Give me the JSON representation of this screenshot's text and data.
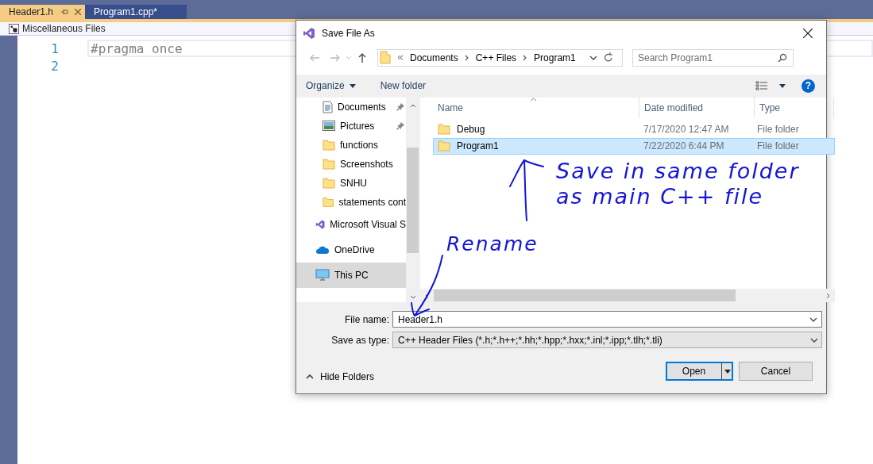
{
  "editor": {
    "tabs": [
      {
        "label": "Header1.h",
        "selected": true
      },
      {
        "label": "Program1.cpp*",
        "selected": false
      }
    ],
    "breadcrumb": "Miscellaneous Files",
    "lines": [
      {
        "number": "1",
        "code": "#pragma once",
        "current": true
      },
      {
        "number": "2",
        "current": false
      }
    ]
  },
  "dialog": {
    "title": "Save File As",
    "path": [
      "Documents",
      "C++ Files",
      "Program1"
    ],
    "search": {
      "placeholder": "Search Program1"
    },
    "toolbar": {
      "organize": "Organize",
      "new_folder": "New folder",
      "help": "?"
    },
    "sidebar": [
      {
        "label": "Documents",
        "kind": "document",
        "pinned": true,
        "selected": false
      },
      {
        "label": "Pictures",
        "kind": "pictures",
        "pinned": true,
        "selected": false
      },
      {
        "label": "functions",
        "kind": "folder",
        "pinned": false,
        "selected": false
      },
      {
        "label": "Screenshots",
        "kind": "folder",
        "pinned": false,
        "selected": false
      },
      {
        "label": "SNHU",
        "kind": "folder",
        "pinned": false,
        "selected": false
      },
      {
        "label": "statements cont",
        "kind": "folder",
        "pinned": false,
        "selected": false
      },
      {
        "label": "Microsoft Visual S",
        "kind": "vs",
        "pinned": false,
        "selected": false
      },
      {
        "label": "OneDrive",
        "kind": "cloud",
        "pinned": false,
        "selected": false
      },
      {
        "label": "This PC",
        "kind": "pc",
        "pinned": false,
        "selected": true
      }
    ],
    "columns": [
      "Name",
      "Date modified",
      "Type"
    ],
    "rows": [
      {
        "name": "Debug",
        "date": "7/17/2020 12:47 AM",
        "type": "File folder",
        "selected": false
      },
      {
        "name": "Program1",
        "date": "7/22/2020 6:44 PM",
        "type": "File folder",
        "selected": true
      }
    ],
    "file_name": {
      "label": "File name:",
      "value": "Header1.h"
    },
    "save_type": {
      "label": "Save as type:",
      "value": "C++ Header Files (*.h;*.h++;*.hh;*.hpp;*.hxx;*.inl;*.ipp;*.tlh;*.tli)"
    },
    "hide_folders": "Hide Folders",
    "buttons": {
      "open": "Open",
      "cancel": "Cancel"
    }
  },
  "annotations": [
    {
      "kind": "note",
      "lines": [
        "Save in same folder",
        "as main C++ file"
      ]
    },
    {
      "kind": "label",
      "lines": [
        "Rename"
      ]
    }
  ]
}
